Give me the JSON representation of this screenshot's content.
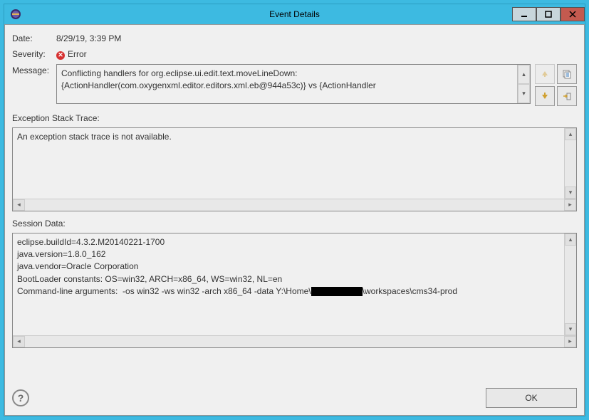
{
  "window": {
    "title": "Event Details"
  },
  "labels": {
    "date": "Date:",
    "severity": "Severity:",
    "message": "Message:",
    "stack": "Exception Stack Trace:",
    "session": "Session Data:"
  },
  "values": {
    "date": "8/29/19, 3:39 PM",
    "severity": "Error",
    "message": "Conflicting handlers for org.eclipse.ui.edit.text.moveLineDown: {ActionHandler(com.oxygenxml.editor.editors.xml.eb@944a53c)} vs {ActionHandler",
    "stack": "An exception stack trace is not available.",
    "session_lines": [
      "eclipse.buildId=4.3.2.M20140221-1700",
      "java.version=1.8.0_162",
      "java.vendor=Oracle Corporation",
      "BootLoader constants: OS=win32, ARCH=x86_64, WS=win32, NL=en",
      "Command-line arguments:  -os win32 -ws win32 -arch x86_64 -data Y:\\Home\\██████\\workspaces\\cms34-prod"
    ]
  },
  "buttons": {
    "ok": "OK"
  }
}
